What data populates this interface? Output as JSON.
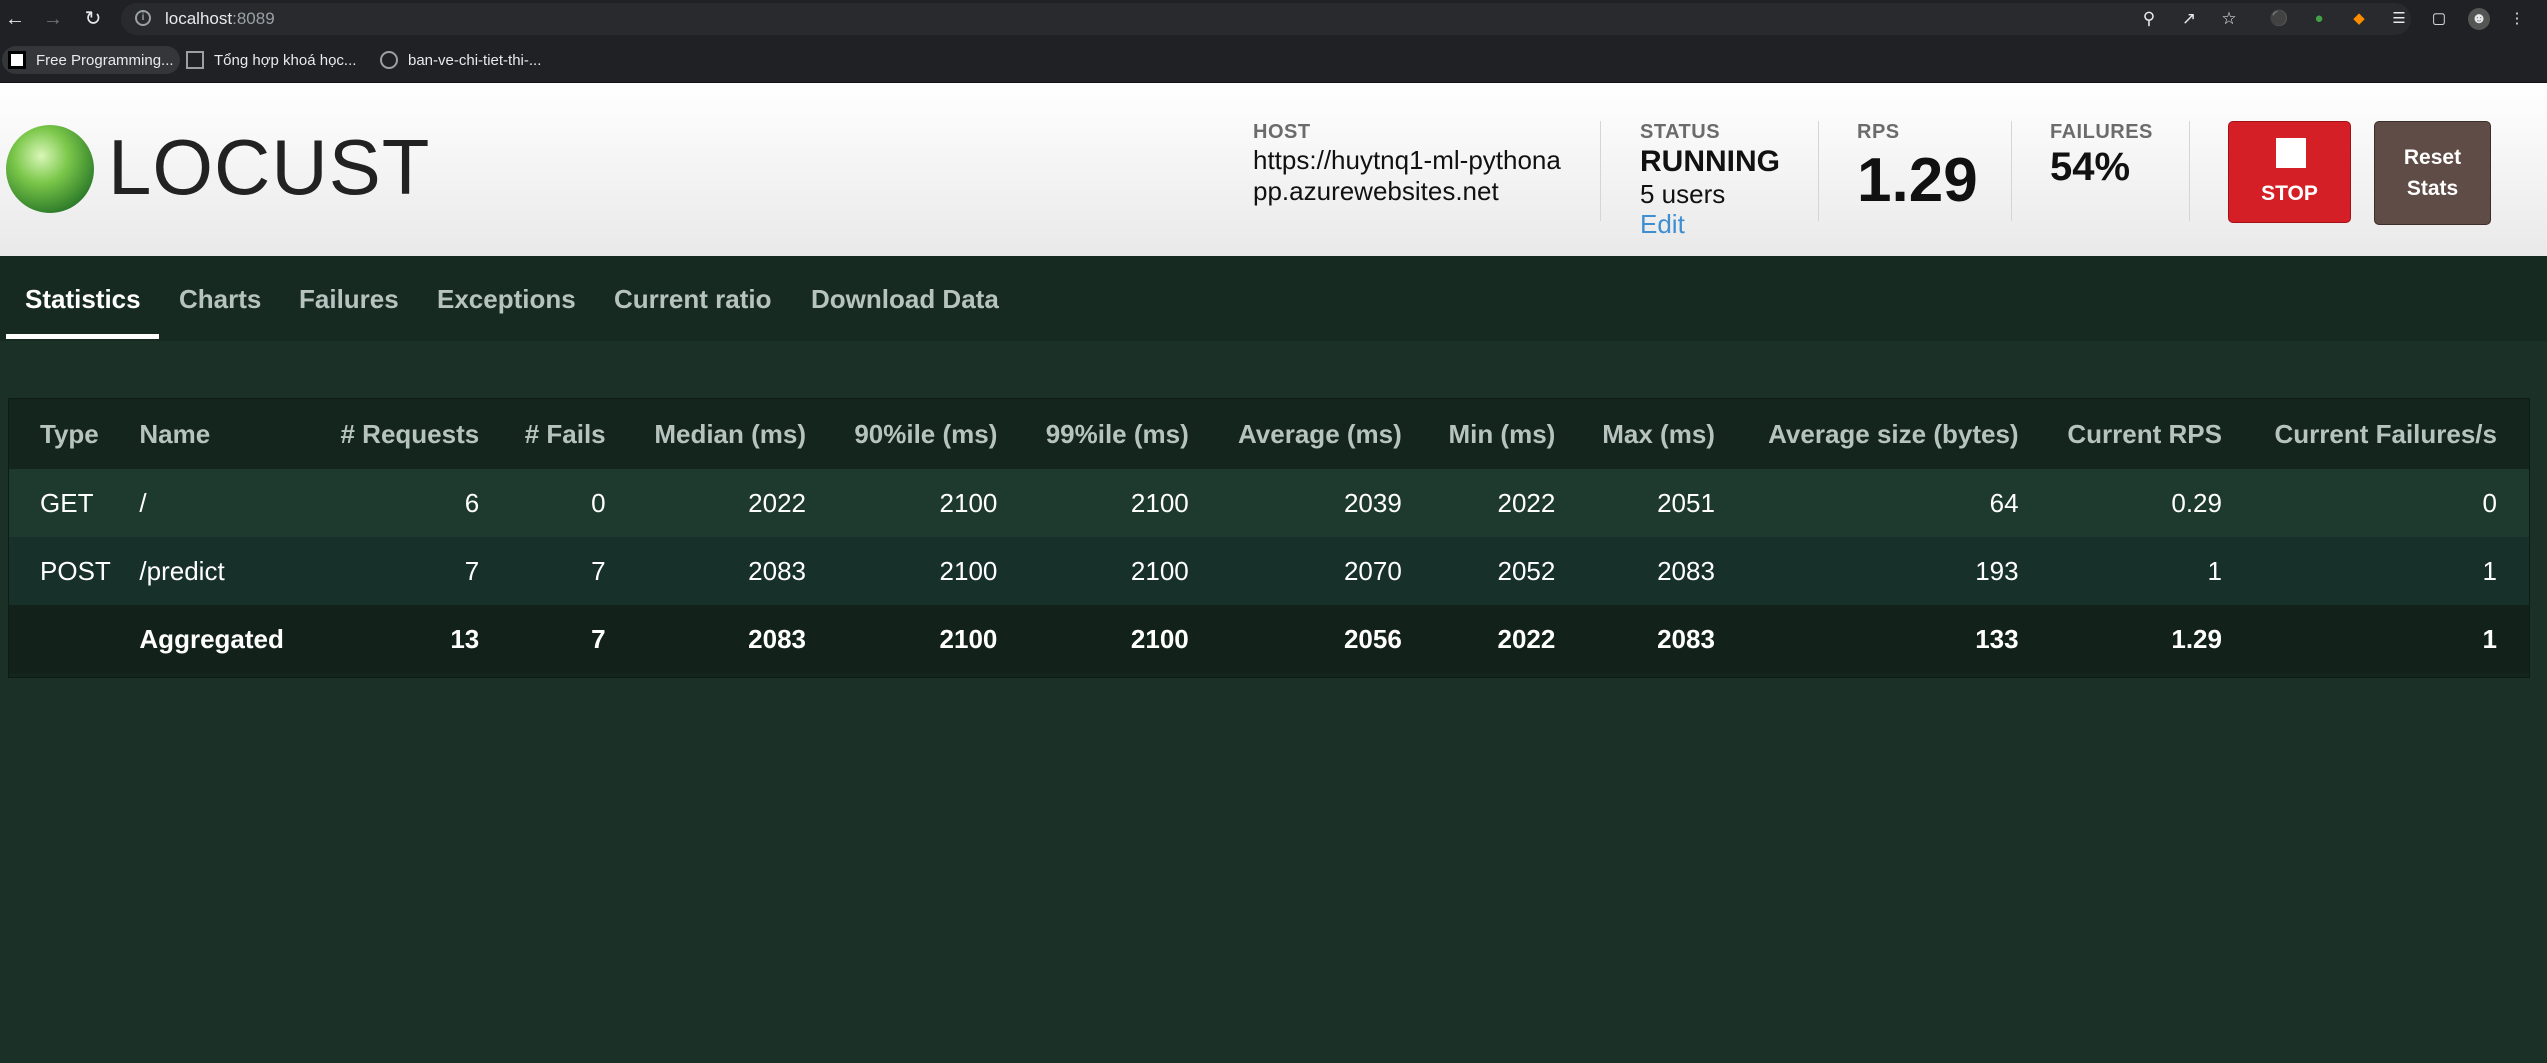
{
  "browser": {
    "url_host": "localhost",
    "url_port": ":8089",
    "bookmarks": [
      "Free Programming...",
      "Tổng hợp khoá học...",
      "ban-ve-chi-tiet-thi-..."
    ]
  },
  "header": {
    "logo_text": "LOCUST",
    "host_label": "HOST",
    "host_value": "https://huytnq1-ml-pythonapp.azurewebsites.net",
    "status_label": "STATUS",
    "status_value": "RUNNING",
    "users_value": "5 users",
    "edit_label": "Edit",
    "rps_label": "RPS",
    "rps_value": "1.29",
    "failures_label": "FAILURES",
    "failures_value": "54%",
    "stop_label": "STOP",
    "reset_label": "Reset Stats"
  },
  "tabs": [
    {
      "label": "Statistics"
    },
    {
      "label": "Charts"
    },
    {
      "label": "Failures"
    },
    {
      "label": "Exceptions"
    },
    {
      "label": "Current ratio"
    },
    {
      "label": "Download Data"
    }
  ],
  "table": {
    "headers": [
      "Type",
      "Name",
      "# Requests",
      "# Fails",
      "Median (ms)",
      "90%ile (ms)",
      "99%ile (ms)",
      "Average (ms)",
      "Min (ms)",
      "Max (ms)",
      "Average size (bytes)",
      "Current RPS",
      "Current Failures/s"
    ],
    "rows": [
      [
        "GET",
        "/",
        "6",
        "0",
        "2022",
        "2100",
        "2100",
        "2039",
        "2022",
        "2051",
        "64",
        "0.29",
        "0"
      ],
      [
        "POST",
        "/predict",
        "7",
        "7",
        "2083",
        "2100",
        "2100",
        "2070",
        "2052",
        "2083",
        "193",
        "1",
        "1"
      ],
      [
        "",
        "Aggregated",
        "13",
        "7",
        "2083",
        "2100",
        "2100",
        "2056",
        "2022",
        "2083",
        "133",
        "1.29",
        "1"
      ]
    ]
  },
  "colors": {
    "background": "#1b3128",
    "stop": "#d51f26",
    "reset": "#5f4c46",
    "edit_link": "#3e8ed0"
  }
}
